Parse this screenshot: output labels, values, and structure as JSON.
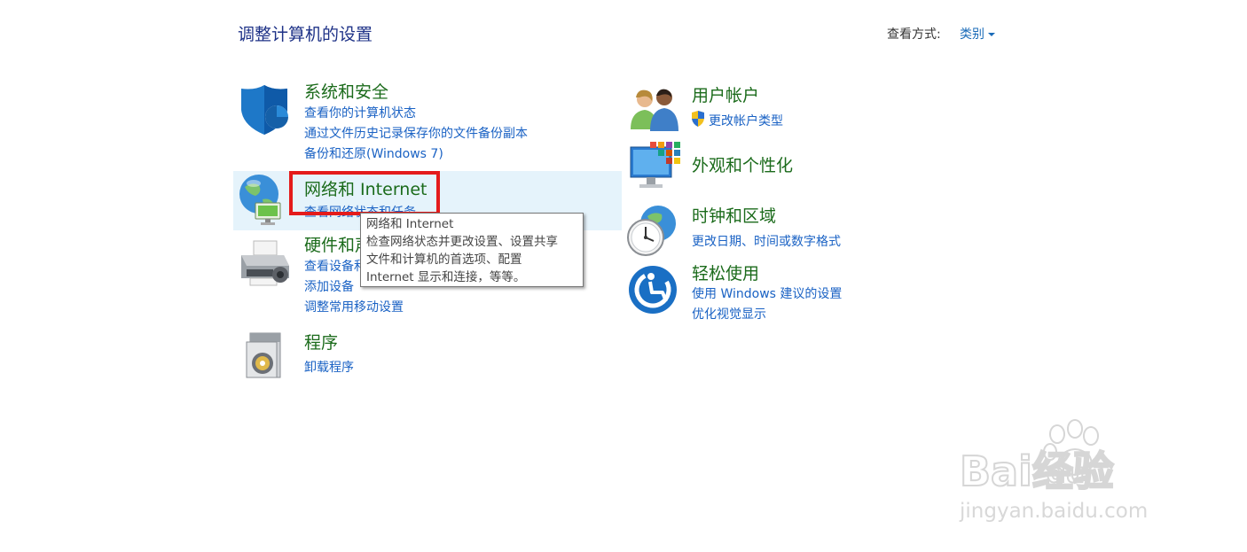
{
  "header": {
    "title": "调整计算机的设置",
    "view_by_label": "查看方式:",
    "view_by_value": "类别"
  },
  "categories": [
    {
      "title": "系统和安全",
      "icon": "shield-icon",
      "links": [
        "查看你的计算机状态",
        "通过文件历史记录保存你的文件备份副本",
        "备份和还原(Windows 7)"
      ]
    },
    {
      "title": "网络和 Internet",
      "icon": "network-globe-icon",
      "links": [
        "查看网络状态和任务"
      ]
    },
    {
      "title": "硬件和声音",
      "icon": "printer-icon",
      "links": [
        "查看设备和打印机",
        "添加设备",
        "调整常用移动设置"
      ]
    },
    {
      "title": "程序",
      "icon": "programs-icon",
      "links": [
        "卸载程序"
      ]
    },
    {
      "title": "用户帐户",
      "icon": "users-icon",
      "links": [
        "更改帐户类型"
      ]
    },
    {
      "title": "外观和个性化",
      "icon": "monitor-icon",
      "links": []
    },
    {
      "title": "时钟和区域",
      "icon": "clock-globe-icon",
      "links": [
        "更改日期、时间或数字格式"
      ]
    },
    {
      "title": "轻松使用",
      "icon": "ease-of-access-icon",
      "links": [
        "使用 Windows 建议的设置",
        "优化视觉显示"
      ]
    }
  ],
  "tooltip": {
    "lines": [
      "网络和 Internet",
      "检查网络状态并更改设置、设置共享",
      "文件和计算机的首选项、配置",
      "Internet 显示和连接，等等。"
    ]
  },
  "watermark": {
    "logo_text": "Bai经验",
    "logo_du": "du",
    "url": "jingyan.baidu.com"
  },
  "colors": {
    "title": "#1e3287",
    "category": "#1b6b1b",
    "link": "#1a62c4",
    "highlight": "#e41b1b",
    "hover": "#e5f3fb"
  }
}
